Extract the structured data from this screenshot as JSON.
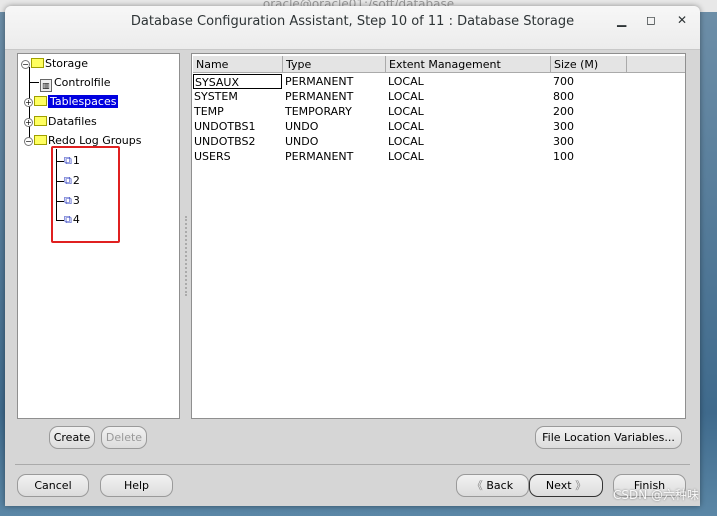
{
  "background_window_title": "oracle@oracle01:/soft/database",
  "window": {
    "title": "Database Configuration Assistant, Step 10 of 11 : Database Storage",
    "minimize_icon": "minimize-icon",
    "maximize_icon": "maximize-icon",
    "close_icon": "close-icon"
  },
  "tree": {
    "root": "Storage",
    "items": [
      {
        "label": "Controlfile",
        "icon": "controlfile-icon"
      },
      {
        "label": "Tablespaces",
        "icon": "folder-icon",
        "selected": true
      },
      {
        "label": "Datafiles",
        "icon": "folder-icon"
      },
      {
        "label": "Redo Log Groups",
        "icon": "folder-icon",
        "expanded": true
      }
    ],
    "redo_groups": [
      "1",
      "2",
      "3",
      "4"
    ],
    "highlight_color": "#e02020"
  },
  "table": {
    "columns": [
      "Name",
      "Type",
      "Extent Management",
      "Size (M)"
    ],
    "rows": [
      [
        "SYSAUX",
        "PERMANENT",
        "LOCAL",
        "700"
      ],
      [
        "SYSTEM",
        "PERMANENT",
        "LOCAL",
        "800"
      ],
      [
        "TEMP",
        "TEMPORARY",
        "LOCAL",
        "200"
      ],
      [
        "UNDOTBS1",
        "UNDO",
        "LOCAL",
        "300"
      ],
      [
        "UNDOTBS2",
        "UNDO",
        "LOCAL",
        "300"
      ],
      [
        "USERS",
        "PERMANENT",
        "LOCAL",
        "100"
      ]
    ]
  },
  "buttons": {
    "create": "Create",
    "delete": "Delete",
    "file_location": "File Location Variables...",
    "cancel": "Cancel",
    "help": "Help",
    "back": "Back",
    "next": "Next",
    "finish": "Finish"
  },
  "watermark": "CSDN @六种味"
}
